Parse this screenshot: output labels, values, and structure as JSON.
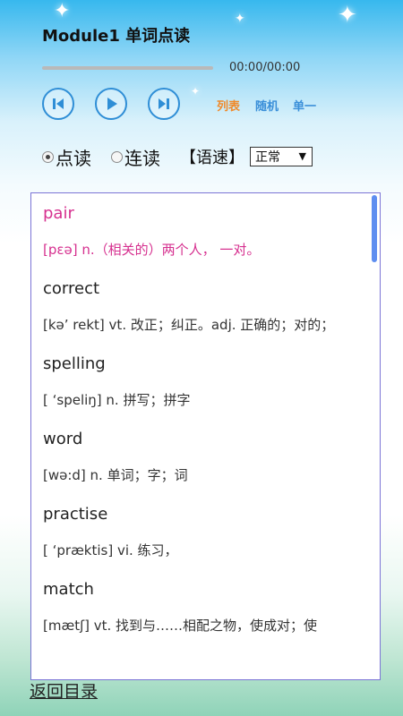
{
  "header": {
    "title": "Module1 单词点读"
  },
  "player": {
    "time": "00:00/00:00",
    "progress": 0,
    "buttons": {
      "prev": "prev-icon",
      "play": "play-icon",
      "next": "next-icon"
    },
    "modes": [
      "列表",
      "随机",
      "单一"
    ],
    "mode_colors": [
      "#f08a2a",
      "#3a8fd9",
      "#3a8fd9"
    ]
  },
  "options": {
    "read_modes": [
      {
        "label": "点读",
        "checked": true
      },
      {
        "label": "连读",
        "checked": false
      }
    ],
    "speed_label": "【语速】",
    "speed_value": "正常"
  },
  "words": [
    {
      "word": "pair",
      "def": "[pɛə] n.（相关的）两个人， 一对。"
    },
    {
      "word": "correct",
      "def": "[kə’ rekt] vt. 改正；纠正。adj. 正确的；对的；"
    },
    {
      "word": "spelling",
      "def": "[ ‘speliŋ] n. 拼写；拼字"
    },
    {
      "word": "word",
      "def": "[wə:d] n. 单词；字；词"
    },
    {
      "word": "practise",
      "def": "[ ‘præktis] vi. 练习，"
    },
    {
      "word": "match",
      "def": "[mætʃ] vt. 找到与……相配之物，使成对；使"
    }
  ],
  "footer": {
    "back_label": "返回目录"
  }
}
